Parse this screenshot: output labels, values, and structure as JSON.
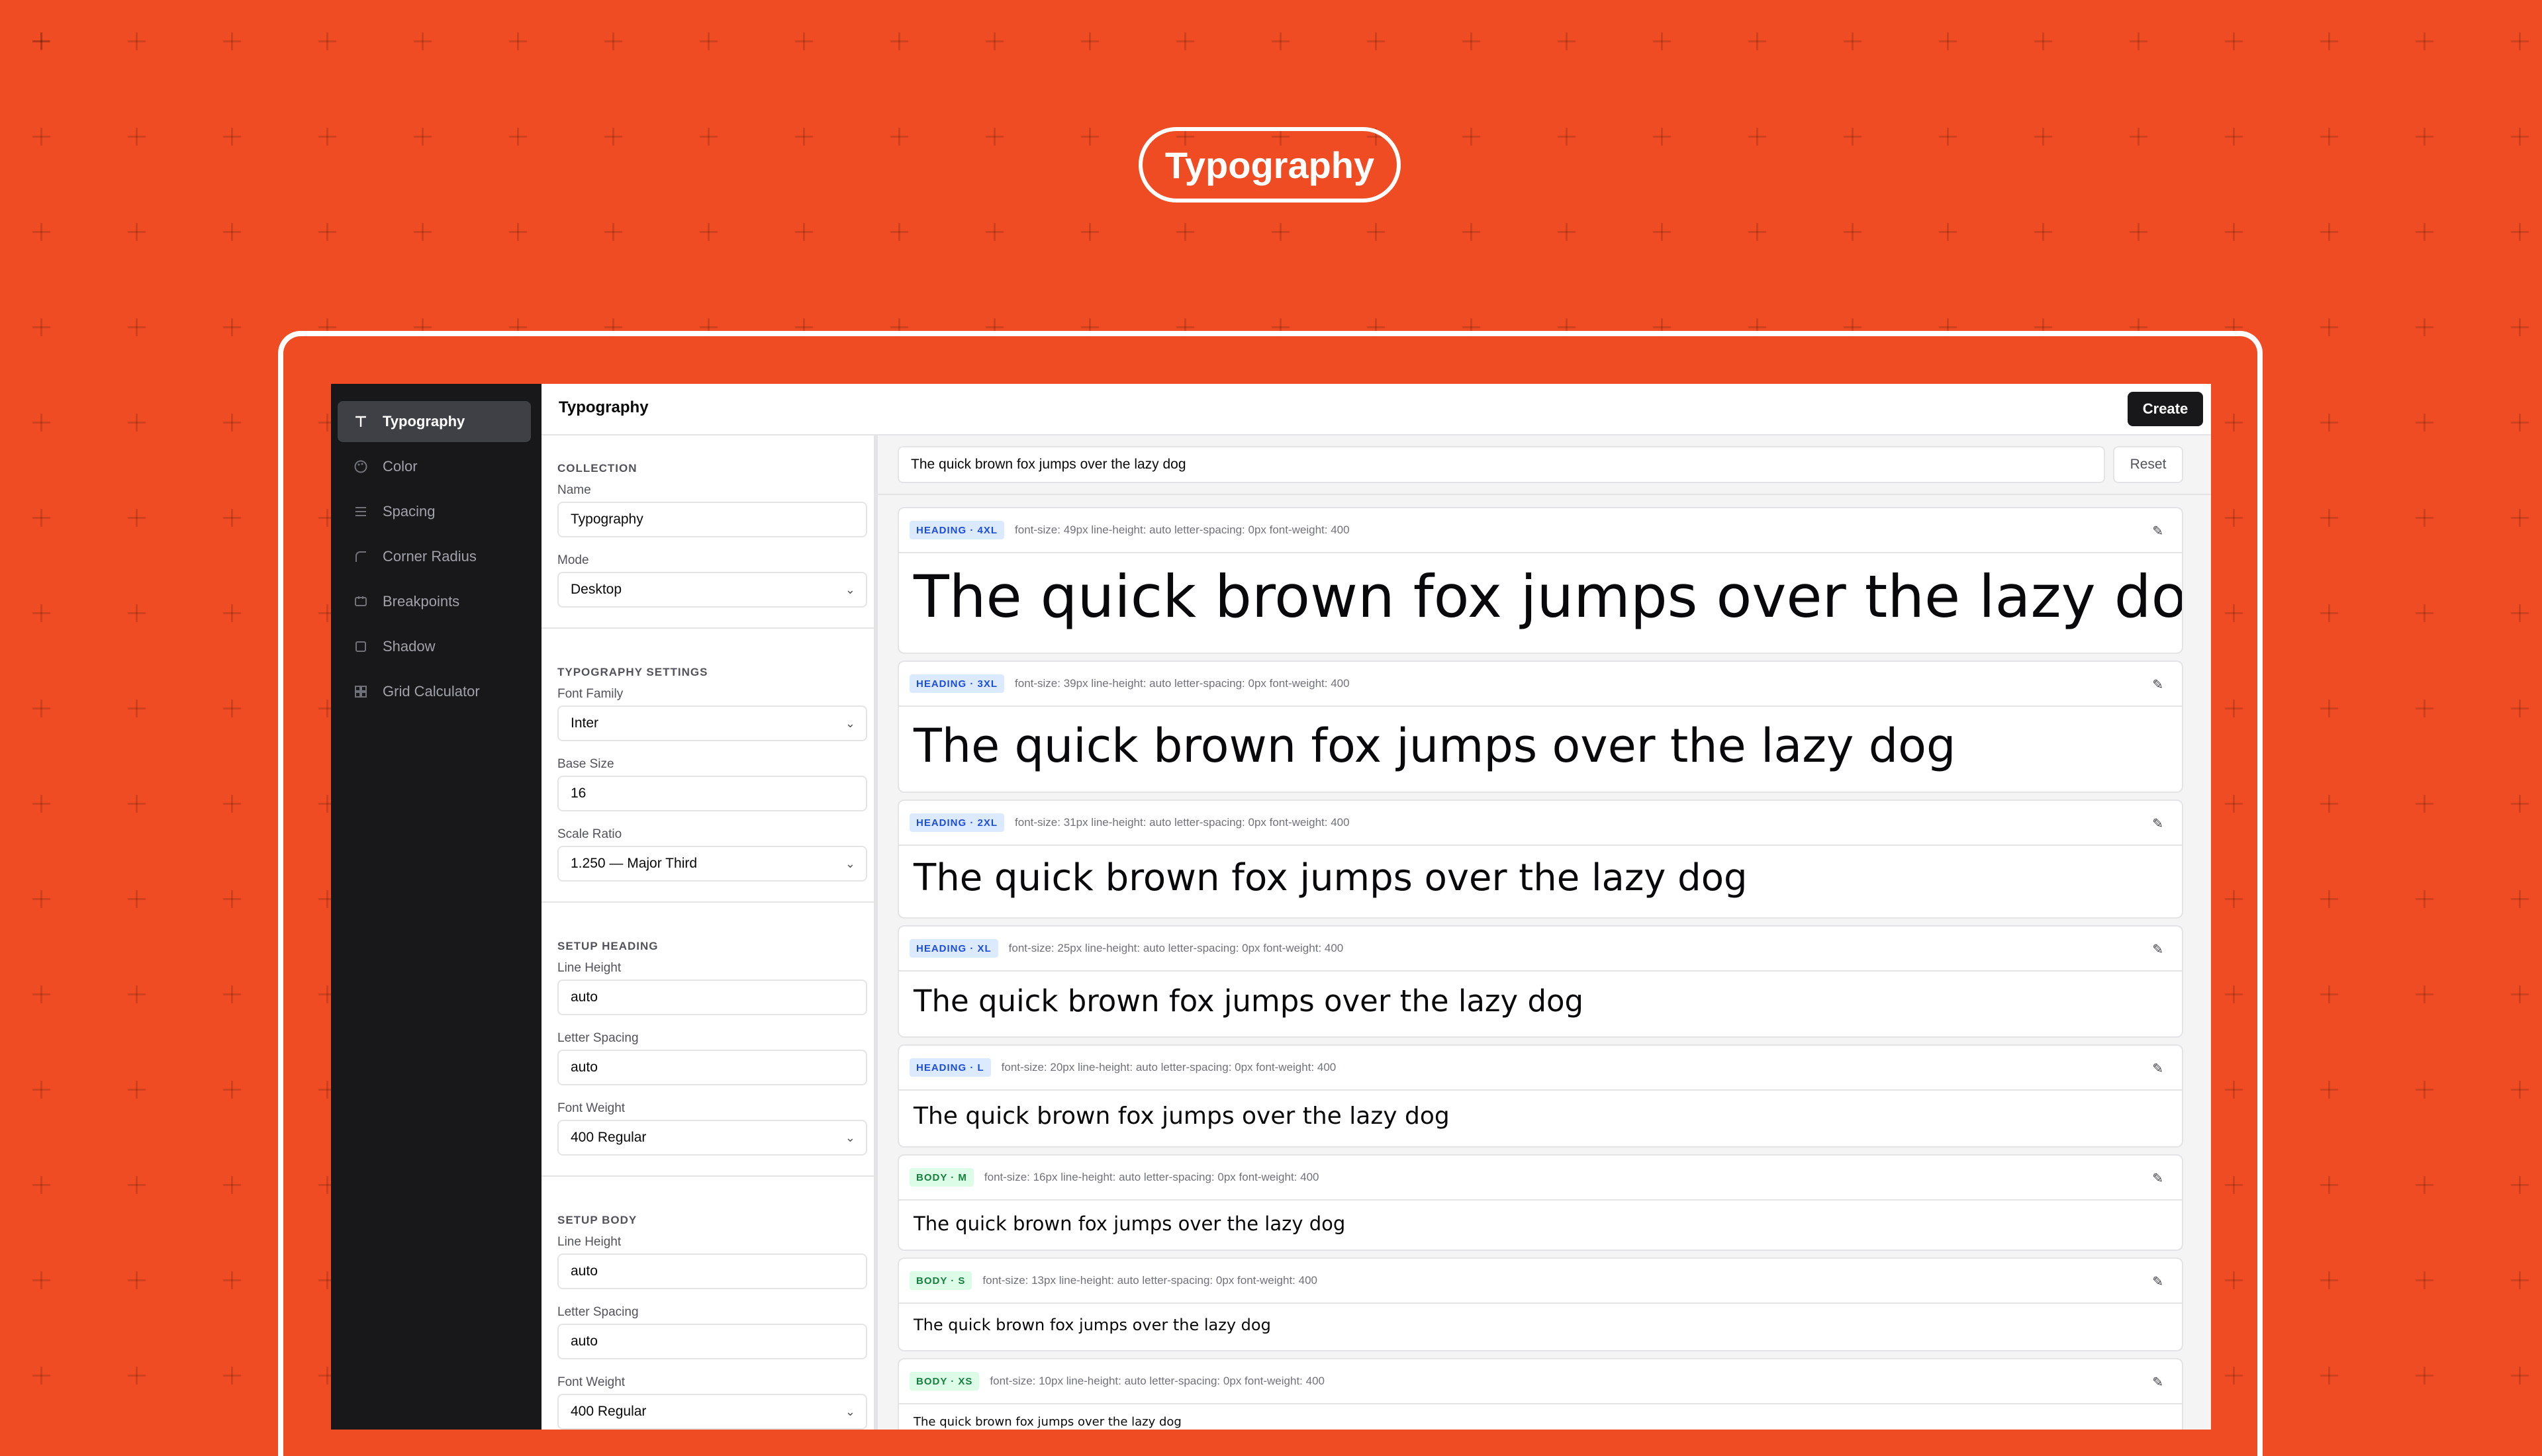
{
  "hero": {
    "title": "Typography"
  },
  "sidebar": {
    "items": [
      {
        "label": "Typography",
        "icon": "type-icon",
        "active": true
      },
      {
        "label": "Color",
        "icon": "palette-icon"
      },
      {
        "label": "Spacing",
        "icon": "spacing-icon"
      },
      {
        "label": "Corner Radius",
        "icon": "corner-radius-icon"
      },
      {
        "label": "Breakpoints",
        "icon": "breakpoints-icon"
      },
      {
        "label": "Shadow",
        "icon": "shadow-icon"
      },
      {
        "label": "Grid Calculator",
        "icon": "grid-icon"
      }
    ]
  },
  "header": {
    "title": "Typography",
    "create_label": "Create"
  },
  "settings": {
    "collection": {
      "title": "COLLECTION",
      "name_label": "Name",
      "name_value": "Typography",
      "mode_label": "Mode",
      "mode_value": "Desktop"
    },
    "typography": {
      "title": "TYPOGRAPHY SETTINGS",
      "font_family_label": "Font Family",
      "font_family_value": "Inter",
      "base_size_label": "Base Size",
      "base_size_value": "16",
      "scale_ratio_label": "Scale Ratio",
      "scale_ratio_value": "1.250 — Major Third"
    },
    "heading": {
      "title": "SETUP HEADING",
      "line_height_label": "Line Height",
      "line_height_value": "auto",
      "letter_spacing_label": "Letter Spacing",
      "letter_spacing_value": "auto",
      "font_weight_label": "Font Weight",
      "font_weight_value": "400 Regular"
    },
    "body": {
      "title": "SETUP BODY",
      "line_height_label": "Line Height",
      "line_height_value": "auto",
      "letter_spacing_label": "Letter Spacing",
      "letter_spacing_value": "auto",
      "font_weight_label": "Font Weight",
      "font_weight_value": "400 Regular"
    }
  },
  "preview": {
    "sample_text": "The quick brown fox jumps over the lazy dog",
    "reset_label": "Reset",
    "cards": [
      {
        "badge": "HEADING · 4XL",
        "meta": "font-size: 49px  line-height: auto  letter-spacing: 0px  font-weight: 400",
        "sample": "The quick brown fox jumps over the lazy dog",
        "kind": "h"
      },
      {
        "badge": "HEADING · 3XL",
        "meta": "font-size: 39px  line-height: auto  letter-spacing: 0px  font-weight: 400",
        "sample": "The quick brown fox jumps over the lazy dog",
        "kind": "h"
      },
      {
        "badge": "HEADING · 2XL",
        "meta": "font-size: 31px  line-height: auto  letter-spacing: 0px  font-weight: 400",
        "sample": "The quick brown fox jumps over the lazy dog",
        "kind": "h"
      },
      {
        "badge": "HEADING · XL",
        "meta": "font-size: 25px  line-height: auto  letter-spacing: 0px  font-weight: 400",
        "sample": "The quick brown fox jumps over the lazy dog",
        "kind": "h"
      },
      {
        "badge": "HEADING · L",
        "meta": "font-size: 20px  line-height: auto  letter-spacing: 0px  font-weight: 400",
        "sample": "The quick brown fox jumps over the lazy dog",
        "kind": "h"
      },
      {
        "badge": "BODY · M",
        "meta": "font-size: 16px  line-height: auto  letter-spacing: 0px  font-weight: 400",
        "sample": "The quick brown fox jumps over the lazy dog",
        "kind": "b"
      },
      {
        "badge": "BODY · S",
        "meta": "font-size: 13px  line-height: auto  letter-spacing: 0px  font-weight: 400",
        "sample": "The quick brown fox jumps over the lazy dog",
        "kind": "b"
      },
      {
        "badge": "BODY · XS",
        "meta": "font-size: 10px  line-height: auto  letter-spacing: 0px  font-weight: 400",
        "sample": "The quick brown fox jumps over the lazy dog",
        "kind": "b"
      }
    ]
  }
}
